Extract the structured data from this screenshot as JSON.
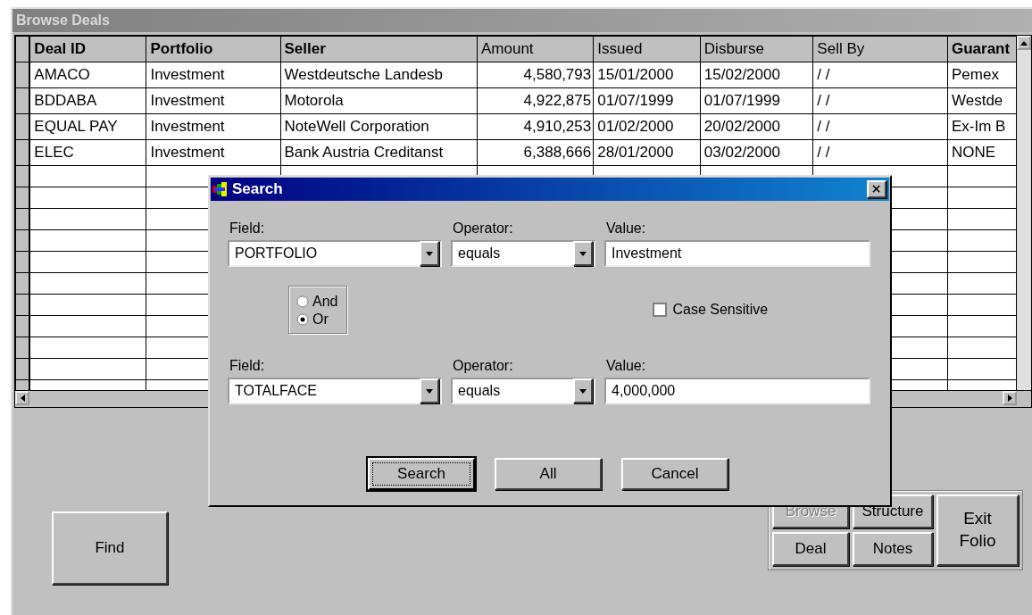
{
  "window": {
    "title": "Browse Deals"
  },
  "grid": {
    "columns": [
      {
        "label": "Deal ID",
        "bold": true
      },
      {
        "label": "Portfolio",
        "bold": true
      },
      {
        "label": "Seller",
        "bold": true
      },
      {
        "label": "Amount",
        "bold": false
      },
      {
        "label": "Issued",
        "bold": false
      },
      {
        "label": "Disburse",
        "bold": false
      },
      {
        "label": "Sell By",
        "bold": false
      },
      {
        "label": "Guarant",
        "bold": true
      }
    ],
    "rows": [
      {
        "cells": [
          "AMACO",
          "Investment",
          "Westdeutsche Landesb",
          "4,580,793",
          "15/01/2000",
          "15/02/2000",
          "/ /",
          "Pemex"
        ]
      },
      {
        "cells": [
          "BDDABA",
          "Investment",
          "Motorola",
          "4,922,875",
          "01/07/1999",
          "01/07/1999",
          "/ /",
          "Westde"
        ]
      },
      {
        "cells": [
          "EQUAL PAY",
          "Investment",
          "NoteWell Corporation",
          "4,910,253",
          "01/02/2000",
          "20/02/2000",
          "/ /",
          "Ex-Im B"
        ]
      },
      {
        "cells": [
          "ELEC",
          "Investment",
          "Bank Austria Creditanst",
          "6,388,666",
          "28/01/2000",
          "03/02/2000",
          "/ /",
          "NONE"
        ]
      }
    ]
  },
  "search_dialog": {
    "title": "Search",
    "criteria": [
      {
        "field_label": "Field:",
        "field": "PORTFOLIO",
        "operator_label": "Operator:",
        "operator": "equals",
        "value_label": "Value:",
        "value": "Investment"
      },
      {
        "field_label": "Field:",
        "field": "TOTALFACE",
        "operator_label": "Operator:",
        "operator": "equals",
        "value_label": "Value:",
        "value": "4,000,000"
      }
    ],
    "logic": [
      {
        "label": "And",
        "selected": false
      },
      {
        "label": "Or",
        "selected": true
      }
    ],
    "case_sensitive": {
      "label": "Case Sensitive",
      "checked": false
    },
    "buttons": [
      {
        "label": "Search",
        "focused": true
      },
      {
        "label": "All",
        "focused": false
      },
      {
        "label": "Cancel",
        "focused": false
      }
    ]
  },
  "find_button": "Find",
  "nav_buttons": [
    {
      "label": "Browse",
      "disabled": true
    },
    {
      "label": "Structure",
      "disabled": false
    },
    {
      "label": "Deal",
      "disabled": false
    },
    {
      "label": "Notes",
      "disabled": false
    }
  ],
  "exit_button": "Exit Folio"
}
